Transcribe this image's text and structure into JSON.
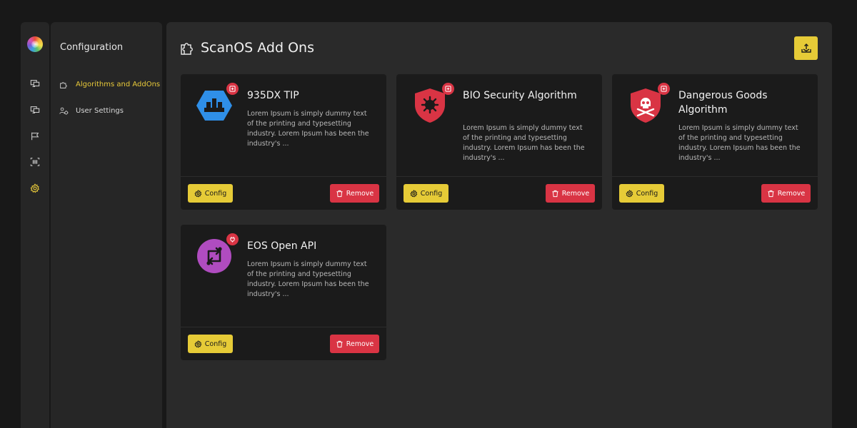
{
  "rail": {
    "icons": [
      "monitor-icon",
      "monitor-icon",
      "flag-icon",
      "barcode-icon",
      "gear-icon"
    ],
    "active_color": "#e8c93a"
  },
  "subnav": {
    "title": "Configuration",
    "items": [
      {
        "label": "Algorithms and AddOns",
        "icon": "puzzle-icon",
        "active": true
      },
      {
        "label": "User Settings",
        "icon": "user-settings-icon",
        "active": false
      }
    ]
  },
  "main": {
    "title": "ScanOS Add Ons",
    "title_icon": "puzzle-icon",
    "export_icon": "export-icon"
  },
  "cards": [
    {
      "title": "935DX TIP",
      "description": "Lorem Ipsum is simply dummy text of the printing and typesetting industry. Lorem Ipsum has been the industry's ...",
      "icon": "tip-hexagon-icon",
      "icon_color": "#2f8fe8",
      "badge_icon": "plus-square-icon",
      "config_label": "Config",
      "remove_label": "Remove"
    },
    {
      "title": "BIO Security Algorithm",
      "description": "Lorem Ipsum is simply dummy text of the printing and typesetting industry. Lorem Ipsum has been the industry's ...",
      "icon": "biohazard-shield-icon",
      "icon_color": "#d93444",
      "badge_icon": "plus-square-icon",
      "config_label": "Config",
      "remove_label": "Remove"
    },
    {
      "title": "Dangerous Goods Algorithm",
      "description": "Lorem Ipsum is simply dummy text of the printing and typesetting industry. Lorem Ipsum has been the industry's ...",
      "icon": "skull-shield-icon",
      "icon_color": "#d93444",
      "badge_icon": "plus-square-icon",
      "config_label": "Config",
      "remove_label": "Remove"
    },
    {
      "title": "EOS Open API",
      "description": "Lorem Ipsum is simply dummy text of the printing and typesetting industry. Lorem Ipsum has been the industry's ...",
      "icon": "api-sync-icon",
      "icon_color": "#b04cc0",
      "badge_icon": "plug-icon",
      "config_label": "Config",
      "remove_label": "Remove"
    }
  ],
  "colors": {
    "accent_yellow": "#e6cb37",
    "danger_red": "#d93444",
    "background": "#181818",
    "panel": "#262626",
    "card": "#1b1b1b"
  }
}
